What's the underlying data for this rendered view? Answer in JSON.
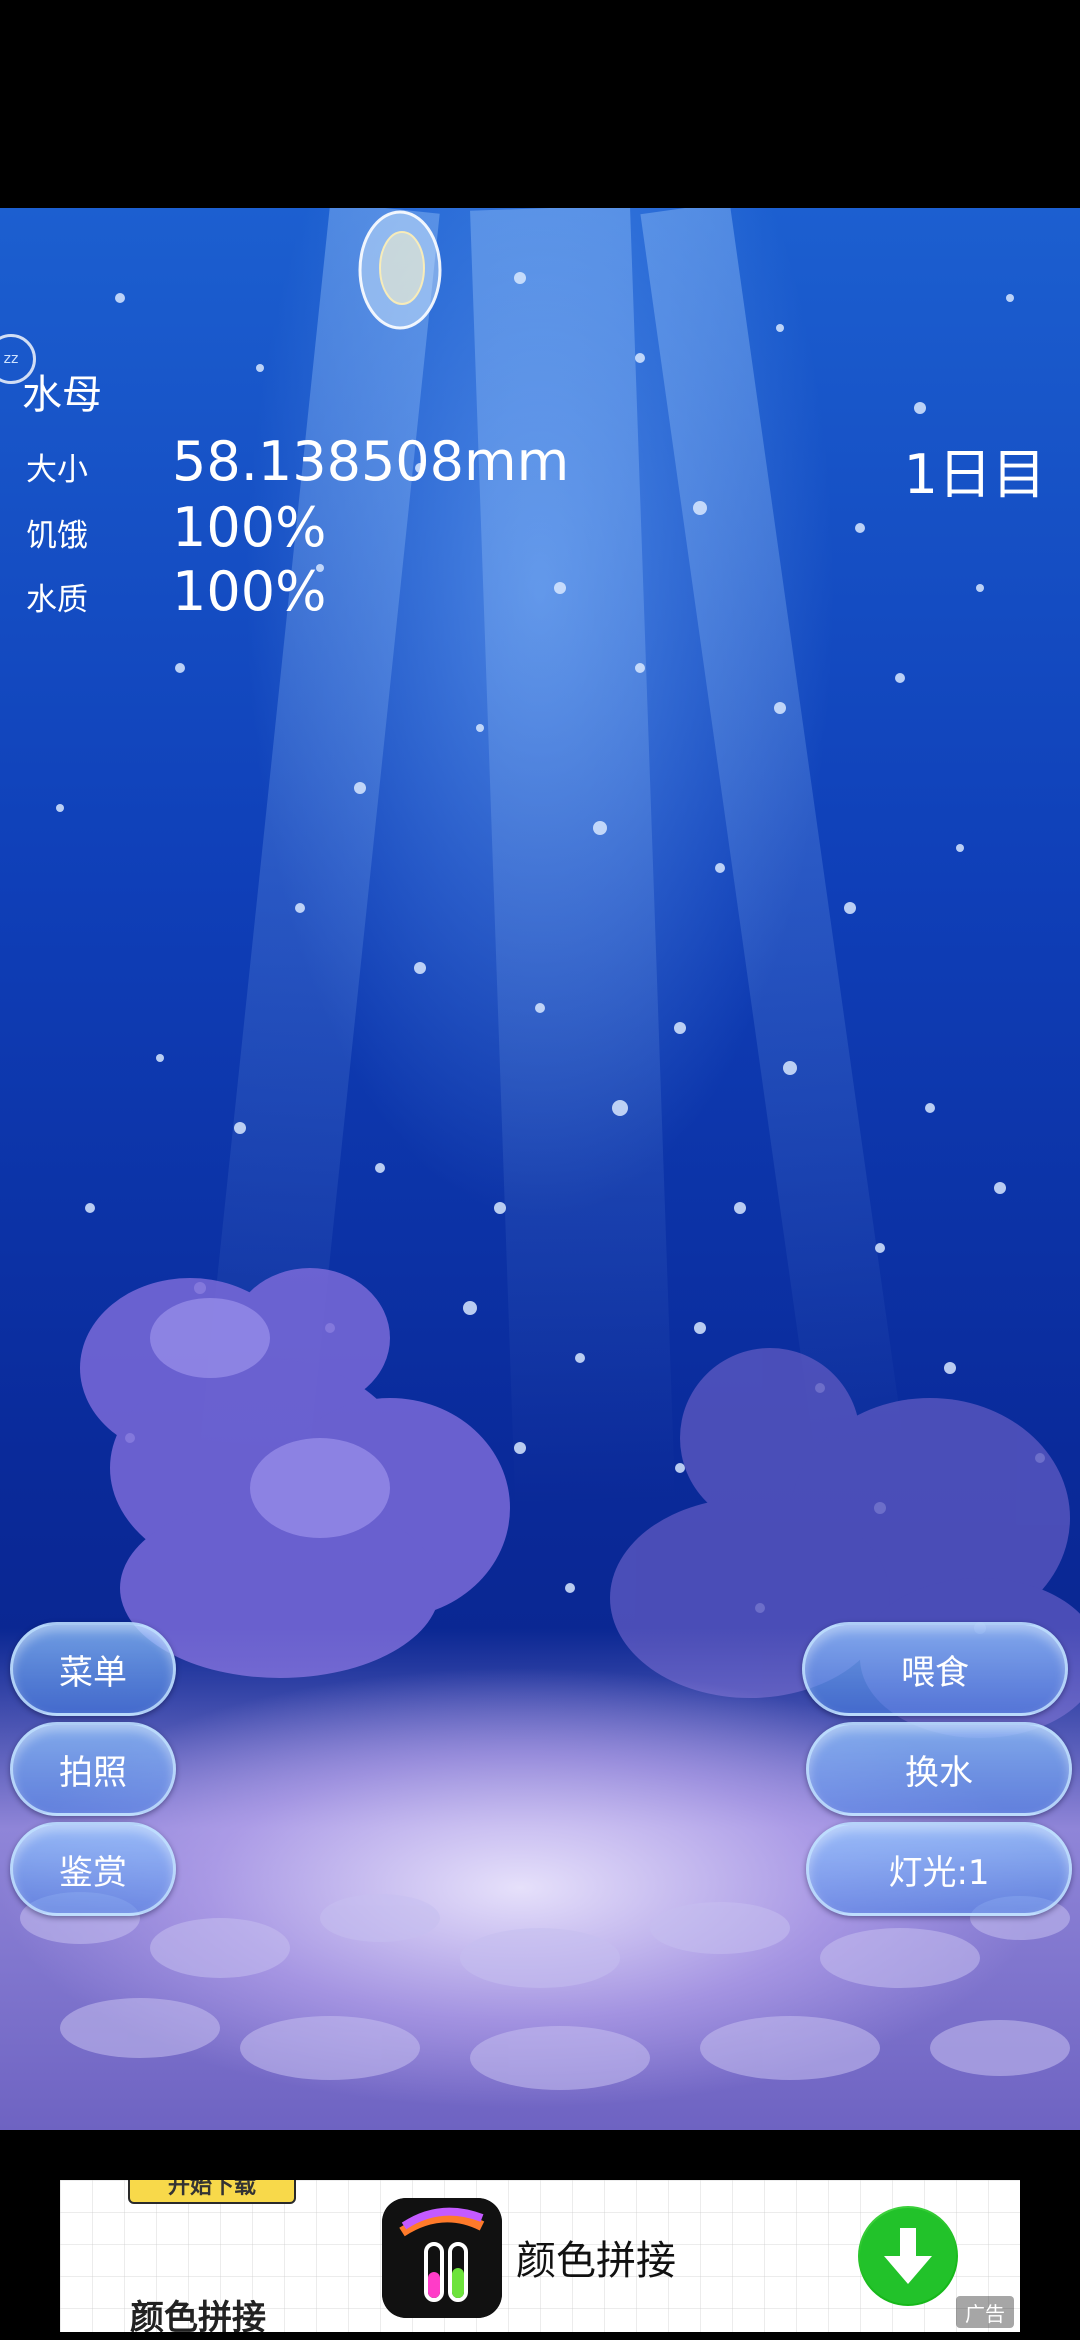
{
  "pet": {
    "name": "水母",
    "size_label": "大小",
    "size_value": "58.138508mm",
    "hunger_label": "饥饿",
    "hunger_value": "100%",
    "water_label": "水质",
    "water_value": "100%",
    "day": "1日目",
    "sleep_icon_text": "zz"
  },
  "buttons_left": {
    "menu": "菜单",
    "photo": "拍照",
    "gallery": "鉴赏"
  },
  "buttons_right": {
    "feed": "喂食",
    "water_change": "换水",
    "light": "灯光:1"
  },
  "ad": {
    "badge": "开始下载",
    "left_title": "颜色拼接",
    "app_title": "颜色拼接",
    "tag": "广告",
    "icon": "download-arrow-icon"
  },
  "colors": {
    "water_top": "#1c5fd0",
    "water_bottom": "#0a1f7e",
    "button": "#5a9be6",
    "download_green": "#16b81a"
  }
}
